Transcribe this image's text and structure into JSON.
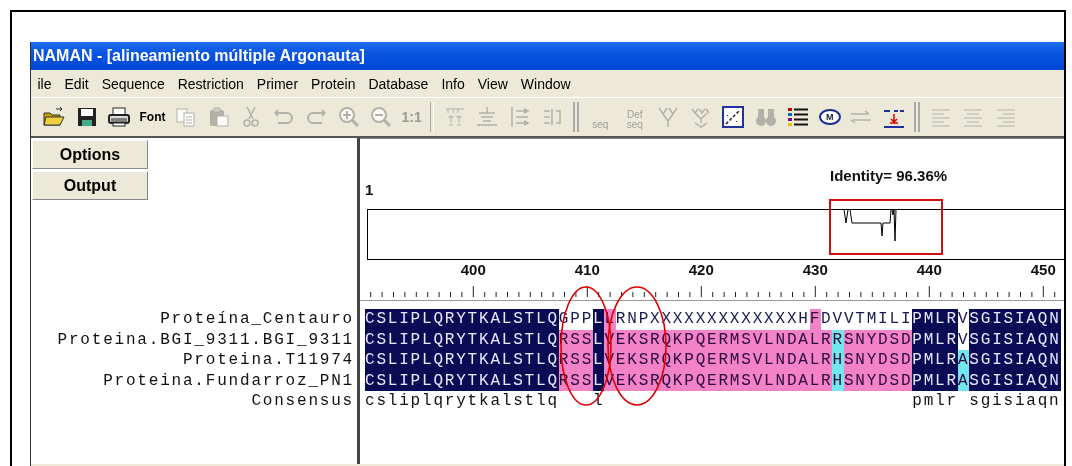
{
  "window": {
    "title": "NAMAN - [alineamiento múltiple Argonauta]"
  },
  "menu": [
    {
      "label": "ile"
    },
    {
      "label": "Edit"
    },
    {
      "label": "Sequence"
    },
    {
      "label": "Restriction"
    },
    {
      "label": "Primer"
    },
    {
      "label": "Protein"
    },
    {
      "label": "Database"
    },
    {
      "label": "Info"
    },
    {
      "label": "View"
    },
    {
      "label": "Window"
    }
  ],
  "toolbar": [
    {
      "kind": "icon",
      "disabled": false
    },
    {
      "kind": "icon",
      "disabled": false
    },
    {
      "kind": "icon",
      "disabled": false
    },
    {
      "kind": "label",
      "label": "Font",
      "disabled": false
    },
    {
      "kind": "icon",
      "disabled": true
    },
    {
      "kind": "icon",
      "disabled": true
    },
    {
      "kind": "icon",
      "disabled": true
    },
    {
      "kind": "icon",
      "disabled": true
    },
    {
      "kind": "icon",
      "disabled": true
    },
    {
      "kind": "icon",
      "disabled": true
    },
    {
      "kind": "icon",
      "disabled": true
    },
    {
      "kind": "label",
      "label": "1:1",
      "disabled": true
    },
    {
      "kind": "separator"
    },
    {
      "kind": "icon",
      "disabled": true
    },
    {
      "kind": "icon",
      "disabled": true
    },
    {
      "kind": "icon",
      "disabled": true
    },
    {
      "kind": "icon",
      "disabled": true
    },
    {
      "kind": "separator"
    },
    {
      "kind": "small-label",
      "label": "seq",
      "disabled": true
    },
    {
      "kind": "small-label",
      "label": "Def seq",
      "disabled": true
    },
    {
      "kind": "icon",
      "disabled": true
    },
    {
      "kind": "icon",
      "disabled": true
    },
    {
      "kind": "icon",
      "disabled": false
    },
    {
      "kind": "icon",
      "disabled": true
    },
    {
      "kind": "icon",
      "disabled": false
    },
    {
      "kind": "badge",
      "label": "M",
      "disabled": false
    },
    {
      "kind": "icon",
      "disabled": true
    },
    {
      "kind": "icon",
      "disabled": false
    },
    {
      "kind": "separator"
    },
    {
      "kind": "icon",
      "disabled": true
    },
    {
      "kind": "icon",
      "disabled": true
    },
    {
      "kind": "icon",
      "disabled": true
    }
  ],
  "side_buttons": [
    {
      "label": "Options"
    },
    {
      "label": "Output"
    }
  ],
  "overview": {
    "start_label": "1",
    "identity": "Identity= 96.36%"
  },
  "ruler": {
    "labels": [
      "400",
      "410",
      "420",
      "430",
      "440",
      "450"
    ]
  },
  "alignment": {
    "rows": [
      {
        "name": "Proteína_Centauro",
        "segments": [
          {
            "text": "CSLIPLQRYTKALSTLQ",
            "color": "#0b0b55"
          },
          {
            "text": "GPP",
            "color": "#ffffff"
          },
          {
            "text": "L",
            "color": "#0b0b55"
          },
          {
            "text": "L",
            "color": "#f382c6"
          },
          {
            "text": "RNPXXXXXXXXXXXXXH",
            "color": "#ffffff"
          },
          {
            "text": "F",
            "color": "#f382c6"
          },
          {
            "text": "DVVTMILI",
            "color": "#ffffff"
          },
          {
            "text": "PMLR",
            "color": "#0b0b55"
          },
          {
            "text": "V",
            "color": "#ffffff"
          },
          {
            "text": "SGISIAQN",
            "color": "#0b0b55"
          }
        ]
      },
      {
        "name": "Proteina.BGI_9311.BGI_9311",
        "segments": [
          {
            "text": "CSLIPLQRYTKALSTLQ",
            "color": "#0b0b55"
          },
          {
            "text": "RSS",
            "color": "#f382c6"
          },
          {
            "text": "L",
            "color": "#0b0b55"
          },
          {
            "text": "VEKSRQKPQERMSVLNDALR",
            "color": "#f382c6"
          },
          {
            "text": "R",
            "color": "#72e8ee"
          },
          {
            "text": "SNYDSD",
            "color": "#f382c6"
          },
          {
            "text": "PMLR",
            "color": "#0b0b55"
          },
          {
            "text": "V",
            "color": "#ffffff"
          },
          {
            "text": "SGISIAQN",
            "color": "#0b0b55"
          }
        ]
      },
      {
        "name": "Proteina.T11974",
        "segments": [
          {
            "text": "CSLIPLQRYTKALSTLQ",
            "color": "#0b0b55"
          },
          {
            "text": "RSS",
            "color": "#f382c6"
          },
          {
            "text": "L",
            "color": "#0b0b55"
          },
          {
            "text": "VEKSRQKPQERMSVLNDALR",
            "color": "#f382c6"
          },
          {
            "text": "H",
            "color": "#72e8ee"
          },
          {
            "text": "SNYDSD",
            "color": "#f382c6"
          },
          {
            "text": "PMLR",
            "color": "#0b0b55"
          },
          {
            "text": "A",
            "color": "#72e8ee"
          },
          {
            "text": "SGISIAQN",
            "color": "#0b0b55"
          }
        ]
      },
      {
        "name": "Proteina.Fundarroz_PN1",
        "segments": [
          {
            "text": "CSLIPLQRYTKALSTLQ",
            "color": "#0b0b55"
          },
          {
            "text": "RSS",
            "color": "#f382c6"
          },
          {
            "text": "L",
            "color": "#0b0b55"
          },
          {
            "text": "VEKSRQKPQERMSVLNDALR",
            "color": "#f382c6"
          },
          {
            "text": "H",
            "color": "#72e8ee"
          },
          {
            "text": "SNYDSD",
            "color": "#f382c6"
          },
          {
            "text": "PMLR",
            "color": "#0b0b55"
          },
          {
            "text": "A",
            "color": "#72e8ee"
          },
          {
            "text": "SGISIAQN",
            "color": "#0b0b55"
          }
        ]
      }
    ],
    "consensus": {
      "name": "Consensus",
      "sequence": "csliplqrytkalstlq   l                           pmlr sgisiaqn"
    }
  }
}
